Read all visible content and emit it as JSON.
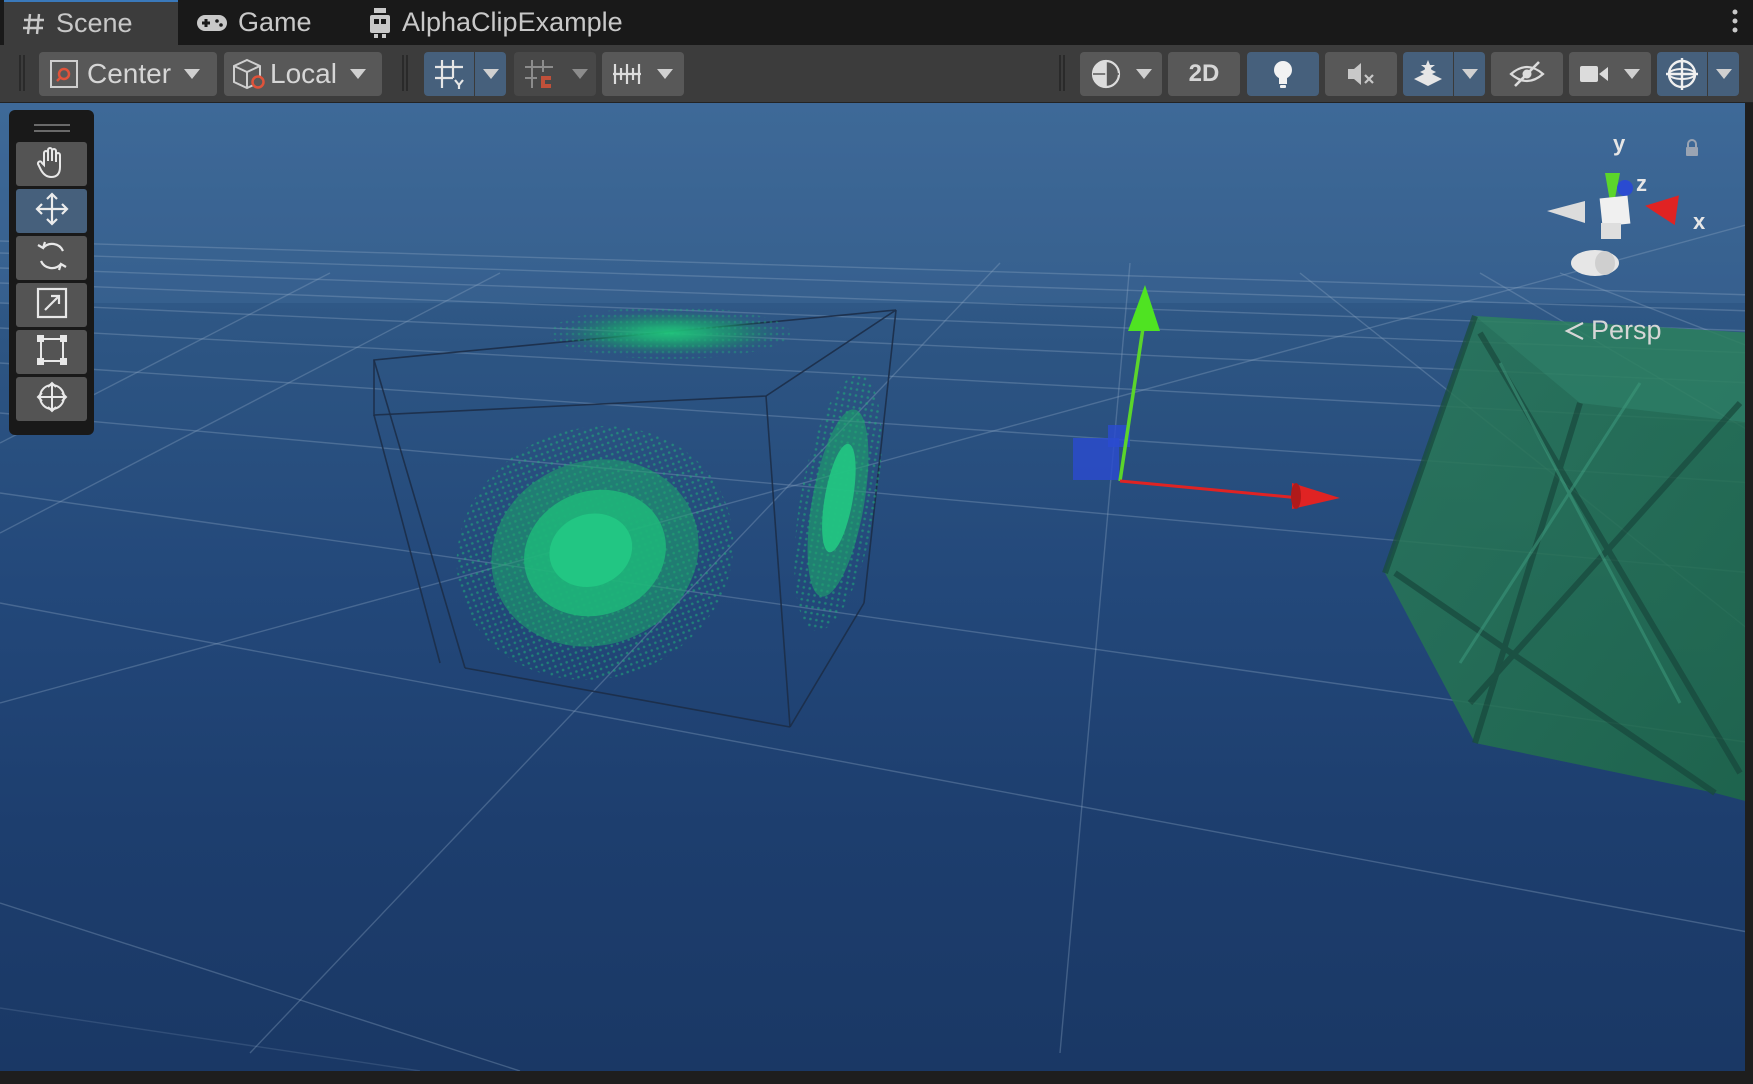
{
  "tabs": [
    {
      "label": "Scene",
      "icon": "hash-icon",
      "active": true
    },
    {
      "label": "Game",
      "icon": "gamepad-icon",
      "active": false
    },
    {
      "label": "AlphaClipExample",
      "icon": "prefab-icon",
      "active": false
    }
  ],
  "toolbar": {
    "pivot_mode_label": "Center",
    "pivot_rotation_label": "Local",
    "toggle_2d_label": "2D"
  },
  "tool_palette": [
    {
      "name": "hand-tool",
      "icon": "hand-icon",
      "active": false
    },
    {
      "name": "move-tool",
      "icon": "move-icon",
      "active": true
    },
    {
      "name": "rotate-tool",
      "icon": "rotate-icon",
      "active": false
    },
    {
      "name": "scale-tool",
      "icon": "scale-icon",
      "active": false
    },
    {
      "name": "rect-tool",
      "icon": "rect-icon",
      "active": false
    },
    {
      "name": "transform-tool",
      "icon": "transform-icon",
      "active": false
    }
  ],
  "gizmo": {
    "axis_y": "y",
    "axis_z": "z",
    "axis_x": "x",
    "projection_label": "Persp"
  },
  "colors": {
    "axis_x": "#e02323",
    "axis_y": "#5bd52b",
    "axis_z": "#2a4bd1",
    "sky_top": "#3a6593",
    "sky_bottom": "#1a3865",
    "accent": "#3a79bb",
    "toggle_on": "#46607c",
    "object_green": "#1fb97a"
  }
}
